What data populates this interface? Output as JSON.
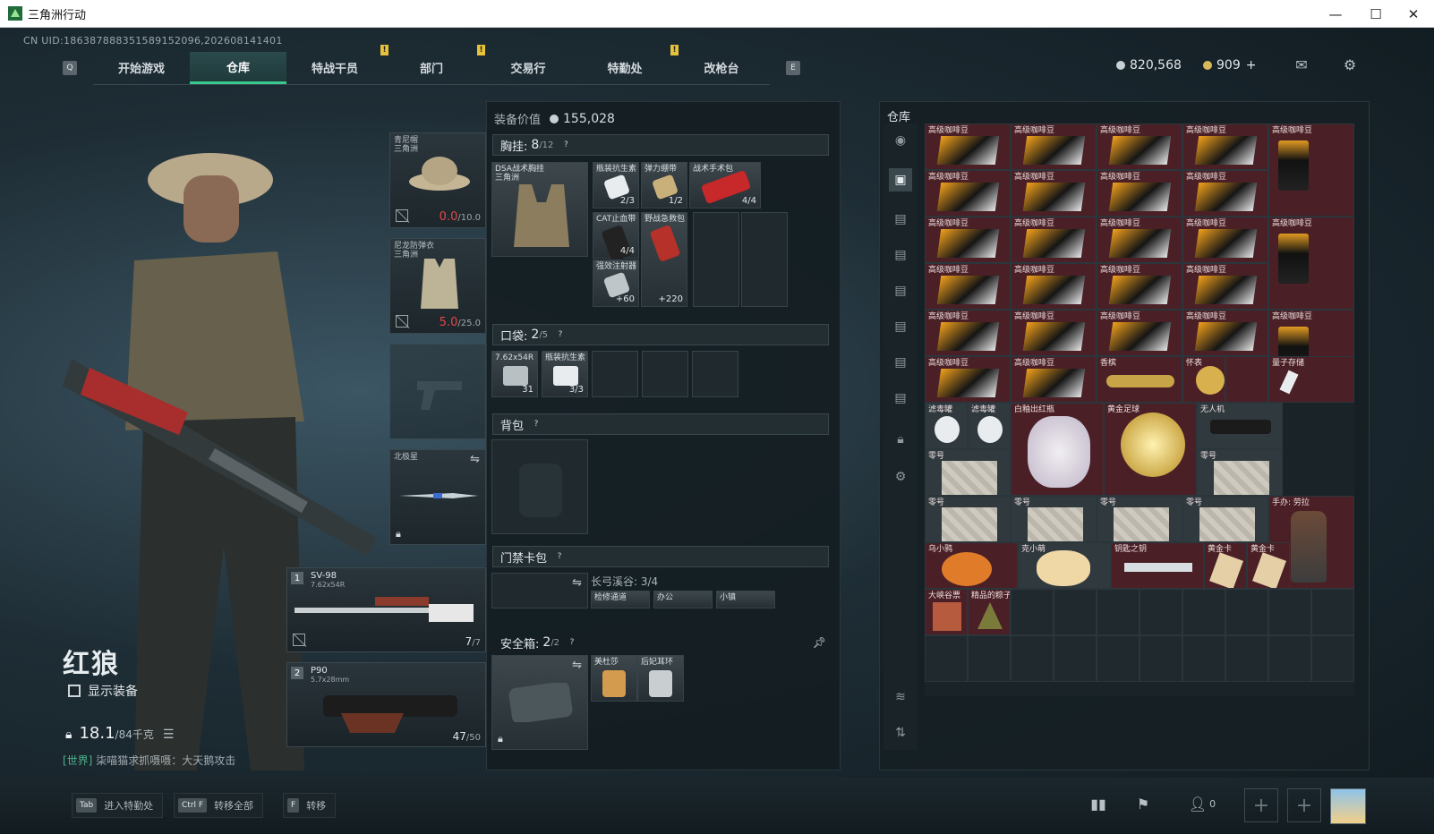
{
  "window": {
    "title": "三角洲行动",
    "minimize": "—",
    "maximize": "☐",
    "close": "✕"
  },
  "uid": "CN UID:18638788835158915209​6,202608141401",
  "nav": {
    "left_key": "Q",
    "right_key": "E",
    "tabs": [
      {
        "label": "开始游戏",
        "active": false,
        "alert": false
      },
      {
        "label": "仓库",
        "active": true,
        "alert": false
      },
      {
        "label": "特战干员",
        "active": false,
        "alert": true
      },
      {
        "label": "部门",
        "active": false,
        "alert": true
      },
      {
        "label": "交易行",
        "active": false,
        "alert": false
      },
      {
        "label": "特勤处",
        "active": false,
        "alert": true
      },
      {
        "label": "改枪台",
        "active": false,
        "alert": false
      }
    ],
    "alert_mark": "!"
  },
  "currency": {
    "silver": "820,568",
    "gold": "909",
    "plus": "+"
  },
  "operator": {
    "name": "红狼",
    "show_equip": "显示装备",
    "weight": "18.1",
    "weight_max": "/84千克"
  },
  "world_msg": {
    "prefix": "[世界]",
    "text": "柒喵猫求抓嗫嗫：大天鹅攻击"
  },
  "equip": {
    "helmet": {
      "label1": "青尼帽",
      "label2": "三角洲",
      "dur": "0.0",
      "dur_max": "/10.0"
    },
    "armor": {
      "label1": "尼龙防弹衣",
      "label2": "三角洲",
      "dur": "5.0",
      "dur_max": "/25.0"
    },
    "melee": {
      "label1": "北极星"
    },
    "gun1": {
      "num": "1",
      "name": "SV-98",
      "ammo_type": "7.62x54R",
      "ammo": "7",
      "ammo_max": "/7"
    },
    "gun2": {
      "num": "2",
      "name": "P90",
      "ammo_type": "5.7x28mm",
      "ammo": "47",
      "ammo_max": "/50"
    }
  },
  "loadout": {
    "value_label": "装备价值",
    "value": "155,028",
    "chest": {
      "label": "胸挂:",
      "num": "8",
      "den": "/12",
      "rig_name": "DSA战术胸挂",
      "rig_sub": "三角洲",
      "items": [
        {
          "label": "瓶装抗生素",
          "count": "2/3"
        },
        {
          "label": "弹力绷带",
          "count": "1/2"
        },
        {
          "label": "战术手术包",
          "count": "4/4"
        },
        {
          "label": "CAT止血带",
          "count": "4/4"
        },
        {
          "label": "野战急救包",
          "count": "+220"
        },
        {
          "label": "强效注射器",
          "count": "+60"
        }
      ]
    },
    "pocket": {
      "label": "口袋:",
      "num": "2",
      "den": "/5",
      "items": [
        {
          "label": "7.62x54R",
          "count": "31"
        },
        {
          "label": "瓶装抗生素",
          "count": "3/3"
        }
      ]
    },
    "backpack": {
      "label": "背包"
    },
    "keycard": {
      "label": "门禁卡包",
      "map_name": "长弓溪谷: 3/4",
      "items": [
        "检修通道",
        "办公",
        "小镇"
      ]
    },
    "safe": {
      "label": "安全箱:",
      "num": "2",
      "den": "/2",
      "items": [
        {
          "label": "美杜莎"
        },
        {
          "label": "后妃耳环"
        }
      ]
    }
  },
  "stash": {
    "title": "仓库",
    "rows": [
      [
        "高级咖啡豆",
        "高级咖啡豆",
        "高级咖啡豆",
        "高级咖啡豆",
        "高级咖啡豆"
      ],
      [
        "高级咖啡豆",
        "高级咖啡豆",
        "高级咖啡豆",
        "高级咖啡豆",
        ""
      ],
      [
        "高级咖啡豆",
        "高级咖啡豆",
        "高级咖啡豆",
        "高级咖啡豆",
        "高级咖啡豆"
      ],
      [
        "高级咖啡豆",
        "高级咖啡豆",
        "高级咖啡豆",
        "高级咖啡豆",
        ""
      ],
      [
        "高级咖啡豆",
        "高级咖啡豆",
        "高级咖啡豆",
        "高级咖啡豆",
        "高级咖啡豆"
      ],
      [
        "高级咖啡豆",
        "高级咖啡豆",
        "香槟",
        "怀表",
        "量子存储"
      ]
    ],
    "special": {
      "filter1": "滤毒罐",
      "filter2": "滤毒罐",
      "vase": "白釉出红瓶",
      "ball": "黄金足球",
      "silencer": "无人机",
      "tape": "零号",
      "figure": "手办: 劳拉",
      "key": "钥匙之钥",
      "card1": "黄金卡",
      "card2": "黄金卡",
      "toy1": "乌小鸦",
      "toy2": "克小萌",
      "stamp": "大峡谷票",
      "zongzi": "精品的粽子"
    }
  },
  "hints": [
    {
      "key": "Tab",
      "label": "进入特勤处"
    },
    {
      "key": "Ctrl F",
      "label": "转移全部"
    },
    {
      "key": "F",
      "label": "转移"
    }
  ],
  "squad_count": "0"
}
